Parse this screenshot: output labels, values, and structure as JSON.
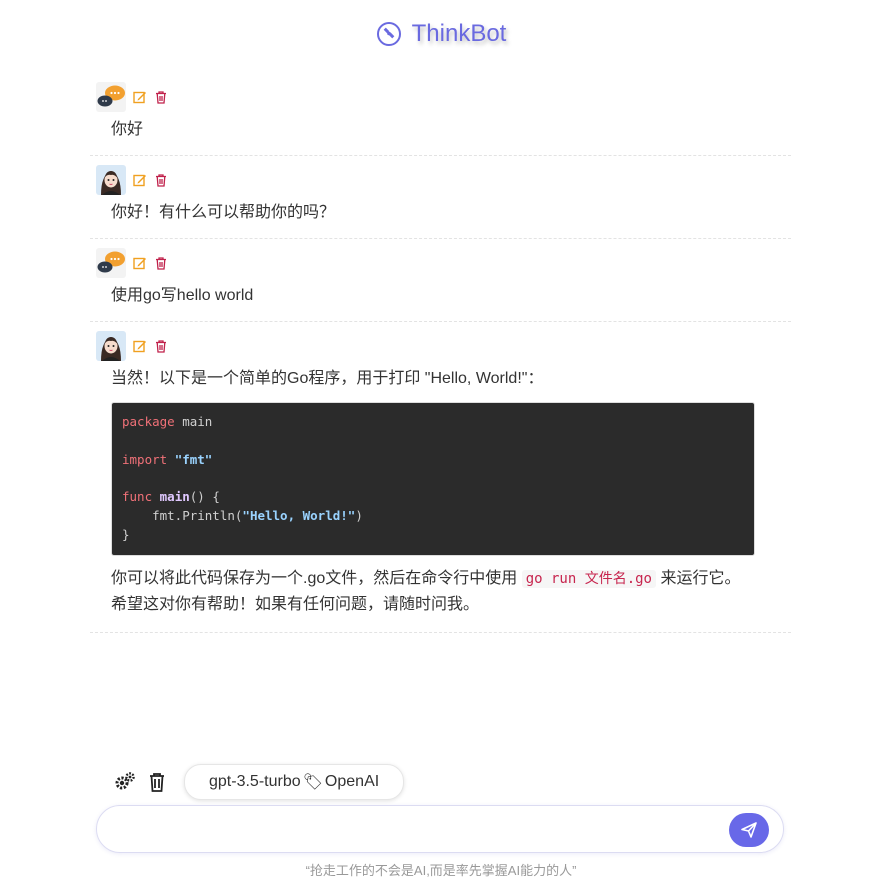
{
  "app": {
    "title": "ThinkBot"
  },
  "messages": [
    {
      "role": "user",
      "text": "你好"
    },
    {
      "role": "bot",
      "text": "你好！有什么可以帮助你的吗？"
    },
    {
      "role": "user",
      "text": "使用go写hello world"
    },
    {
      "role": "bot",
      "intro": "当然！以下是一个简单的Go程序，用于打印 \"Hello, World!\"：",
      "code": {
        "l1_kw": "package",
        "l1_rest": " main",
        "l3_kw": "import",
        "l3_str": "\"fmt\"",
        "l5_kw": "func",
        "l5_fn": "main",
        "l5_rest": "() {",
        "l6_pre": "    fmt.Println(",
        "l6_str": "\"Hello, World!\"",
        "l6_post": ")",
        "l7": "}"
      },
      "after_1": "你可以将此代码保存为一个.go文件，然后在命令行中使用 ",
      "after_code": "go run 文件名.go",
      "after_2": " 来运行它。希望这对你有帮助！如果有任何问题，请随时问我。"
    }
  ],
  "toolbar": {
    "model_name": "gpt-3.5-turbo",
    "model_emoji": "🏷",
    "provider": "OpenAI"
  },
  "input": {
    "value": "",
    "placeholder": ""
  },
  "footer": {
    "text": "“抢走工作的不会是AI,而是率先掌握AI能力的人”"
  },
  "colors": {
    "accent": "#6868e8",
    "title": "#6a6ae0",
    "edit": "#f0a020",
    "delete": "#c0204a"
  }
}
